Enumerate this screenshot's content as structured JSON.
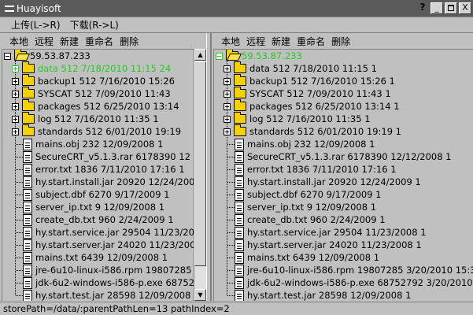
{
  "window": {
    "title": "Huayisoft",
    "help": "?",
    "minimize": "_",
    "close": "X"
  },
  "menu": {
    "upload": "上传(L->R)",
    "download": "下载(R->L)"
  },
  "toolbar": {
    "local": "本地",
    "remote": "远程",
    "new": "新建",
    "rename": "重命名",
    "delete": "删除"
  },
  "left": {
    "root": "59.53.87.233",
    "folders": [
      "data   512  7/18/2010 11:15 24",
      "backup1   512  7/16/2010 15:26",
      "SYSCAT   512  7/09/2010 11:43",
      "packages   512  6/25/2010 13:14",
      "log   512  7/16/2010 11:35 1",
      "standards   512  6/01/2010 19:19"
    ],
    "files": [
      "mains.obj   232 12/09/2008   1",
      "SecureCRT_v5.1.3.rar 6178390 12",
      "error.txt   1836  7/11/2010 17:16 1",
      "hy.start.install.jar 20920 12/24/200",
      "subject.dbf  6270  9/17/2009   1",
      "server_ip.txt   9 12/09/2008   1",
      "create_db.txt  960  2/24/2009   1",
      "hy.start.service.jar 29504 11/23/20",
      "hy.start.server.jar 24020 11/23/200",
      "mains.txt   6439 12/09/2008   1",
      "jre-6u10-linux-i586.rpm 19807285",
      "jdk-6u2-windows-i586-p.exe 68752",
      "hy.start.test.jar 28598 12/09/2008"
    ]
  },
  "right": {
    "root": "59.53.87.233",
    "folders": [
      "data   512  7/18/2010 11:15 1",
      "backup1   512  7/16/2010 15:26 1",
      "SYSCAT   512  7/09/2010 11:43 1",
      "packages   512  6/25/2010 13:14 1",
      "log   512  7/16/2010 11:35 1",
      "standards   512  6/01/2010 19:19 1"
    ],
    "files": [
      "mains.obj   232 12/09/2008   1",
      "SecureCRT_v5.1.3.rar 6178390 12/12/2008   1",
      "error.txt   1836  7/11/2010 17:16 1",
      "hy.start.install.jar 20920 12/24/2009   1",
      "subject.dbf  6270  9/17/2009   1",
      "server_ip.txt   9 12/09/2008   1",
      "create_db.txt  960  2/24/2009   1",
      "hy.start.service.jar 29504 11/23/2008   1",
      "hy.start.server.jar 24020 11/23/2008   1",
      "mains.txt   6439 12/09/2008   1",
      "jre-6u10-linux-i586.rpm 19807285  3/20/2010 15:3",
      "jdk-6u2-windows-i586-p.exe 68752792  3/20/2010",
      "hy.start.test.jar 28598 12/09/2008   1"
    ]
  },
  "status": "storePath=/data/:parentPathLen=13 pathIndex=2",
  "colors": {
    "selected_text": "#22cc22",
    "folder": "#f7d000",
    "titlebar": "#5a5a5a"
  }
}
